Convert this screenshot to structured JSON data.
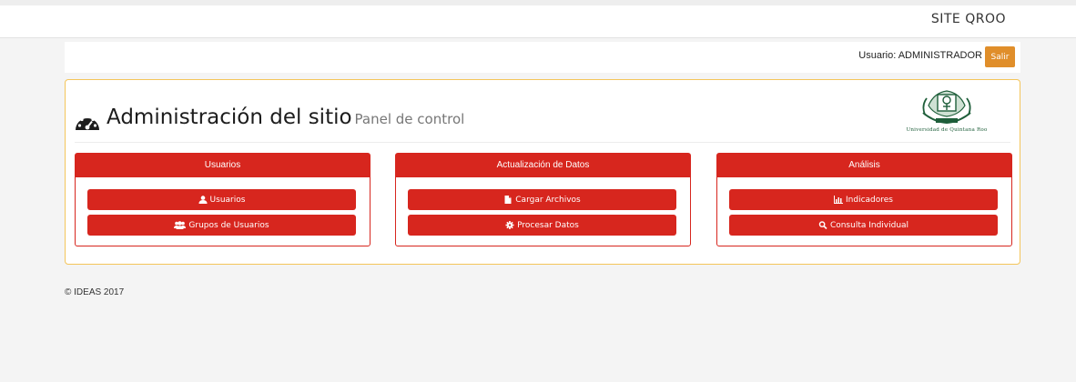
{
  "navbar": {
    "brand": "SITE QROO"
  },
  "userbar": {
    "user_label": "Usuario: ADMINISTRADOR",
    "logout": "Salir"
  },
  "header": {
    "title": "Administración del sitio",
    "subtitle": "Panel de control",
    "logo_caption": "Universidad de Quintana Roo"
  },
  "sections": [
    {
      "title": "Usuarios",
      "buttons": [
        {
          "label": "Usuarios",
          "icon": "user-icon"
        },
        {
          "label": "Grupos de Usuarios",
          "icon": "users-icon"
        }
      ]
    },
    {
      "title": "Actualización de Datos",
      "buttons": [
        {
          "label": "Cargar Archivos",
          "icon": "file-icon"
        },
        {
          "label": "Procesar Datos",
          "icon": "gear-icon"
        }
      ]
    },
    {
      "title": "Análisis",
      "buttons": [
        {
          "label": "Indicadores",
          "icon": "bar-chart-icon"
        },
        {
          "label": "Consulta Individual",
          "icon": "search-icon"
        }
      ]
    }
  ],
  "footer": {
    "copyright": "© IDEAS 2017"
  },
  "colors": {
    "primary": "#d7261e",
    "warning": "#e08e2a",
    "panel_border": "#f4c55a",
    "logo_green": "#1e5e3a"
  }
}
